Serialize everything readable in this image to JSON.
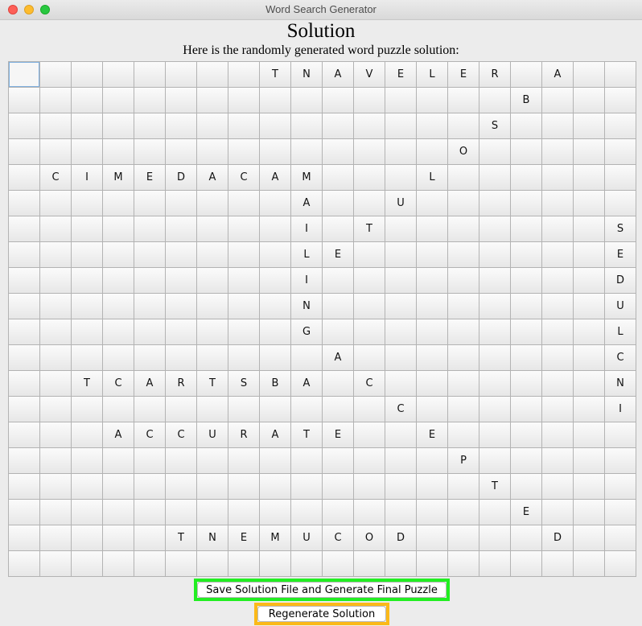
{
  "window": {
    "title": "Word Search Generator"
  },
  "heading": "Solution",
  "subheading": "Here is the randomly generated word puzzle solution:",
  "grid": [
    [
      "",
      "",
      "",
      "",
      "",
      "",
      "",
      "",
      "T",
      "N",
      "A",
      "V",
      "E",
      "L",
      "E",
      "R",
      "",
      "A",
      "",
      ""
    ],
    [
      "",
      "",
      "",
      "",
      "",
      "",
      "",
      "",
      "",
      "",
      "",
      "",
      "",
      "",
      "",
      "",
      "B",
      "",
      "",
      ""
    ],
    [
      "",
      "",
      "",
      "",
      "",
      "",
      "",
      "",
      "",
      "",
      "",
      "",
      "",
      "",
      "",
      "S",
      "",
      "",
      "",
      ""
    ],
    [
      "",
      "",
      "",
      "",
      "",
      "",
      "",
      "",
      "",
      "",
      "",
      "",
      "",
      "",
      "O",
      "",
      "",
      "",
      "",
      ""
    ],
    [
      "",
      "C",
      "I",
      "M",
      "E",
      "D",
      "A",
      "C",
      "A",
      "M",
      "",
      "",
      "",
      "L",
      "",
      "",
      "",
      "",
      "",
      ""
    ],
    [
      "",
      "",
      "",
      "",
      "",
      "",
      "",
      "",
      "",
      "A",
      "",
      "",
      "U",
      "",
      "",
      "",
      "",
      "",
      "",
      ""
    ],
    [
      "",
      "",
      "",
      "",
      "",
      "",
      "",
      "",
      "",
      "I",
      "",
      "T",
      "",
      "",
      "",
      "",
      "",
      "",
      "",
      "S"
    ],
    [
      "",
      "",
      "",
      "",
      "",
      "",
      "",
      "",
      "",
      "L",
      "E",
      "",
      "",
      "",
      "",
      "",
      "",
      "",
      "",
      "E"
    ],
    [
      "",
      "",
      "",
      "",
      "",
      "",
      "",
      "",
      "",
      "I",
      "",
      "",
      "",
      "",
      "",
      "",
      "",
      "",
      "",
      "D"
    ],
    [
      "",
      "",
      "",
      "",
      "",
      "",
      "",
      "",
      "",
      "N",
      "",
      "",
      "",
      "",
      "",
      "",
      "",
      "",
      "",
      "U"
    ],
    [
      "",
      "",
      "",
      "",
      "",
      "",
      "",
      "",
      "",
      "G",
      "",
      "",
      "",
      "",
      "",
      "",
      "",
      "",
      "",
      "L"
    ],
    [
      "",
      "",
      "",
      "",
      "",
      "",
      "",
      "",
      "",
      "",
      "A",
      "",
      "",
      "",
      "",
      "",
      "",
      "",
      "",
      "C"
    ],
    [
      "",
      "",
      "T",
      "C",
      "A",
      "R",
      "T",
      "S",
      "B",
      "A",
      "",
      "C",
      "",
      "",
      "",
      "",
      "",
      "",
      "",
      "N"
    ],
    [
      "",
      "",
      "",
      "",
      "",
      "",
      "",
      "",
      "",
      "",
      "",
      "",
      "C",
      "",
      "",
      "",
      "",
      "",
      "",
      "I"
    ],
    [
      "",
      "",
      "",
      "A",
      "C",
      "C",
      "U",
      "R",
      "A",
      "T",
      "E",
      "",
      "",
      "E",
      "",
      "",
      "",
      "",
      "",
      ""
    ],
    [
      "",
      "",
      "",
      "",
      "",
      "",
      "",
      "",
      "",
      "",
      "",
      "",
      "",
      "",
      "P",
      "",
      "",
      "",
      "",
      ""
    ],
    [
      "",
      "",
      "",
      "",
      "",
      "",
      "",
      "",
      "",
      "",
      "",
      "",
      "",
      "",
      "",
      "T",
      "",
      "",
      "",
      ""
    ],
    [
      "",
      "",
      "",
      "",
      "",
      "",
      "",
      "",
      "",
      "",
      "",
      "",
      "",
      "",
      "",
      "",
      "E",
      "",
      "",
      ""
    ],
    [
      "",
      "",
      "",
      "",
      "",
      "T",
      "N",
      "E",
      "M",
      "U",
      "C",
      "O",
      "D",
      "",
      "",
      "",
      "",
      "D",
      "",
      ""
    ],
    [
      "",
      "",
      "",
      "",
      "",
      "",
      "",
      "",
      "",
      "",
      "",
      "",
      "",
      "",
      "",
      "",
      "",
      "",
      "",
      ""
    ]
  ],
  "buttons": {
    "save_label": "Save Solution File and Generate Final Puzzle",
    "save_border_color": "#22ee22",
    "regenerate_label": "Regenerate Solution",
    "regenerate_border_color": "#fbb919"
  }
}
